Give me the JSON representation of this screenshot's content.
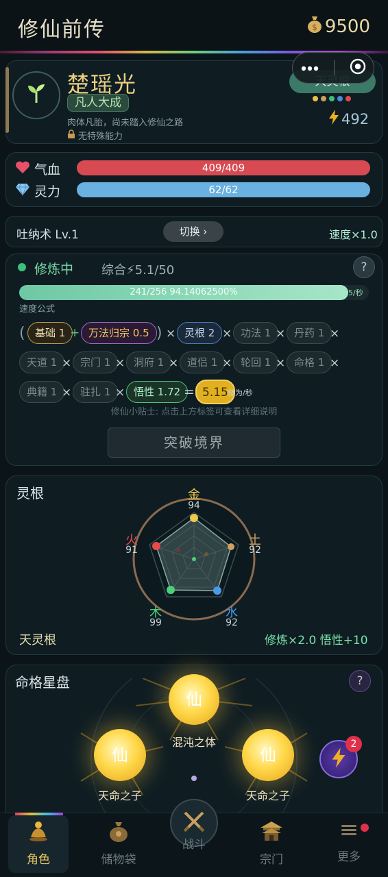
{
  "header": {
    "title": "修仙前传",
    "coins": "9500"
  },
  "character": {
    "name": "楚瑶光",
    "realm": "凡人大成",
    "description": "肉体凡胎，尚未踏入修仙之路",
    "ability": "无特殊能力",
    "root_badge": "天灵根",
    "power": "492",
    "root_dot_colors": [
      "#e8c24a",
      "#c8a060",
      "#3ac07a",
      "#4a8ae0",
      "#e04a4a"
    ]
  },
  "stats": {
    "hp": {
      "label": "气血",
      "value": "409/409",
      "fill": 1.0,
      "color": "#d84a52"
    },
    "mp": {
      "label": "灵力",
      "value": "62/62",
      "fill": 1.0,
      "color": "#6ab0e0"
    }
  },
  "technique": {
    "name": "吐纳术 Lv.1",
    "switch_label": "切换 ›",
    "speed": "速度×1.0"
  },
  "cultivation": {
    "status": "修炼中",
    "total": "综合⚡5.1/50",
    "help": "?",
    "progress_text": "241/256  94.14062500%",
    "progress": 0.9414,
    "rate_small": "5/秒",
    "formula_label": "速度公式",
    "tip": "修仙小贴士: 点击上方标签可查看详细说明",
    "breakthrough": "突破境界",
    "chips": {
      "base": "基础 1",
      "wanfa": "万法归宗 0.5",
      "root": "灵根 2",
      "gongfa": "功法 1",
      "danyao": "丹药 1",
      "tiandao": "天道 1",
      "zongmen": "宗门 1",
      "dongfu": "洞府 1",
      "daolv": "道侣 1",
      "lunhui": "轮回 1",
      "mingge": "命格 1",
      "dianji": "典籍 1",
      "zhuzha": "驻扎 1",
      "wuxing": "悟性 1.72",
      "result": "5.15",
      "result_unit": "修为/秒"
    },
    "ops": {
      "open": "(",
      "close": ")",
      "plus": "+",
      "times": "×",
      "equals": "="
    }
  },
  "spirit_root": {
    "title": "灵根",
    "type": "天灵根",
    "bonus": "修炼×2.0  悟性+10",
    "elements": [
      {
        "name": "金",
        "value": "94",
        "color": "#f0c84a"
      },
      {
        "name": "土",
        "value": "92",
        "color": "#d0a060"
      },
      {
        "name": "水",
        "value": "92",
        "color": "#4a9ae8"
      },
      {
        "name": "木",
        "value": "99",
        "color": "#4ad07a"
      },
      {
        "name": "火",
        "value": "91",
        "color": "#e84a4a"
      }
    ]
  },
  "star_disk": {
    "title": "命格星盘",
    "help": "?",
    "center": {
      "glyph": "仙",
      "name": "混沌之体"
    },
    "left": {
      "glyph": "仙",
      "name": "天命之子"
    },
    "right": {
      "glyph": "仙",
      "name": "天命之子"
    },
    "badge": "2"
  },
  "nav": [
    {
      "label": "角色",
      "active": true
    },
    {
      "label": "储物袋",
      "active": false
    },
    {
      "label": "战斗",
      "active": false
    },
    {
      "label": "宗门",
      "active": false
    },
    {
      "label": "更多",
      "active": false
    }
  ]
}
